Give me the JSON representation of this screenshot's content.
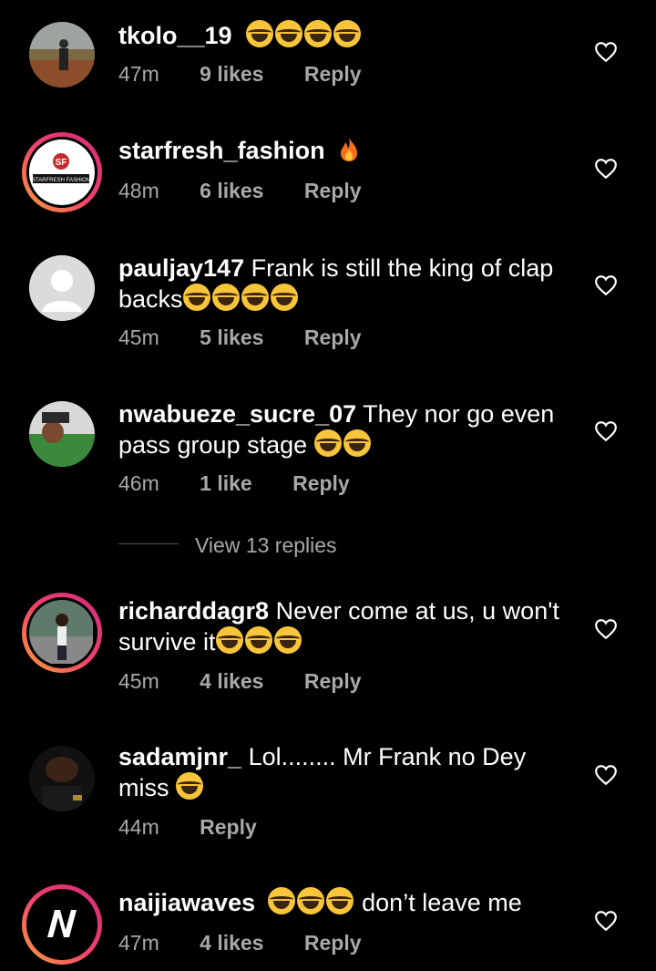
{
  "comments": [
    {
      "username": "tkolo__19",
      "text": "",
      "emoji_count": 4,
      "time": "47m",
      "likes": "9 likes",
      "reply": "Reply"
    },
    {
      "username": "starfresh_fashion",
      "text": "",
      "time": "48m",
      "likes": "6 likes",
      "reply": "Reply",
      "avatar_text": "STARFRESH FASHION"
    },
    {
      "username": "pauljay147",
      "text": "Frank is still the king of clap",
      "text2": "backs",
      "emoji_count": 4,
      "time": "45m",
      "likes": "5 likes",
      "reply": "Reply"
    },
    {
      "username": "nwabueze_sucre_07",
      "text": "They nor go even",
      "text2": "pass group stage",
      "emoji_count": 2,
      "time": "46m",
      "likes": "1 like",
      "reply": "Reply"
    },
    {
      "username": "richarddagr8",
      "text": "Never come at us, u won't",
      "text2": "survive it",
      "emoji_count": 3,
      "time": "45m",
      "likes": "4 likes",
      "reply": "Reply"
    },
    {
      "username": "sadamjnr_",
      "text": "Lol........ Mr Frank no Dey",
      "text2": "miss",
      "emoji_count": 1,
      "time": "44m",
      "likes": "",
      "reply": "Reply"
    },
    {
      "username": "naijiawaves",
      "text": "don’t leave me",
      "emoji_count": 3,
      "time": "47m",
      "likes": "4 likes",
      "reply": "Reply"
    }
  ],
  "view_replies": "View 13 replies",
  "colors": {
    "background": "#000000",
    "meta": "#a8a8a8",
    "emoji": "#f8c53a",
    "ring_start": "#f9a13a",
    "ring_end": "#d42b7c"
  },
  "icons": {
    "heart": "heart-outline-icon",
    "emoji": "laughing-tears-emoji",
    "fire": "fire-emoji"
  }
}
